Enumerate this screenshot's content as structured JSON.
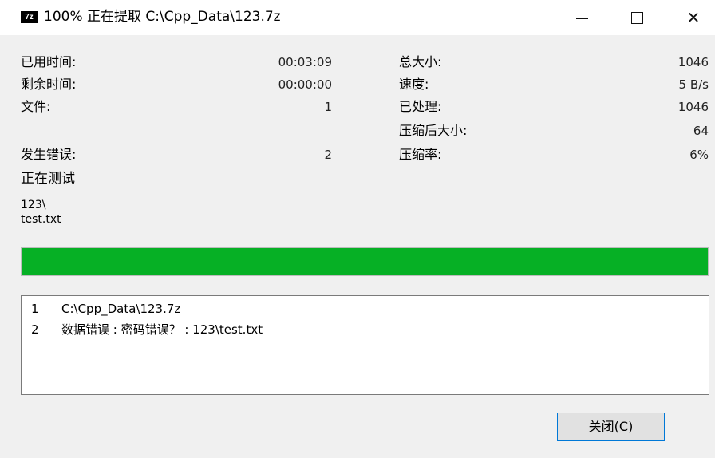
{
  "window": {
    "icon_label": "7z",
    "title": "100% 正在提取 C:\\Cpp_Data\\123.7z",
    "close_glyph": "✕"
  },
  "stats": {
    "elapsed_label": "已用时间:",
    "elapsed_value": "00:03:09",
    "remaining_label": "剩余时间:",
    "remaining_value": "00:00:00",
    "files_label": "文件:",
    "files_value": "1",
    "errors_label": "发生错误:",
    "errors_value": "2",
    "total_size_label": "总大小:",
    "total_size_value": "1046",
    "speed_label": "速度:",
    "speed_value": "5 B/s",
    "processed_label": "已处理:",
    "processed_value": "1046",
    "compressed_size_label": "压缩后大小:",
    "compressed_size_value": "64",
    "ratio_label": "压缩率:",
    "ratio_value": "6%"
  },
  "status": {
    "operation": "正在测试",
    "current_path": "123\\",
    "current_file": "test.txt"
  },
  "progress": {
    "percent": 100,
    "color": "#06b025"
  },
  "log": {
    "rows": [
      {
        "num": "1",
        "text": "C:\\Cpp_Data\\123.7z"
      },
      {
        "num": "2",
        "text": "数据错误 : 密码错误？ : 123\\test.txt"
      }
    ]
  },
  "buttons": {
    "close_label": "关闭(C)"
  }
}
